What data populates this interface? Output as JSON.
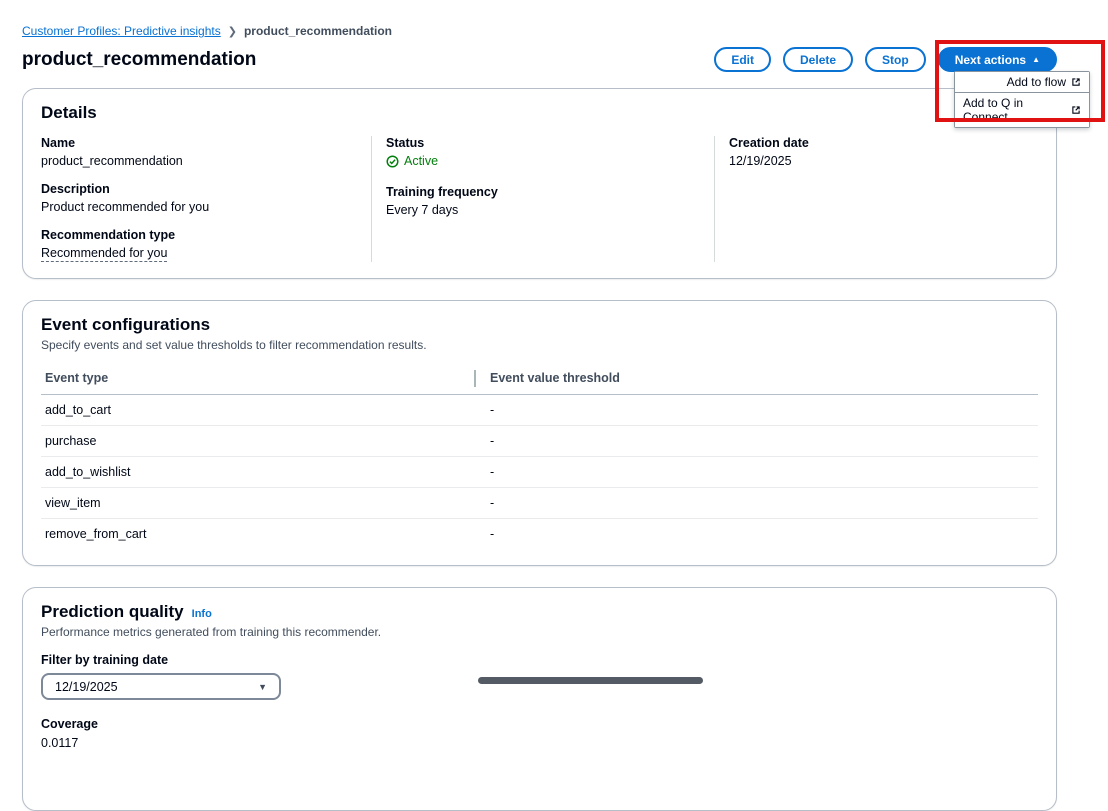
{
  "colors": {
    "accent": "#0972d3",
    "status_active": "#037f0c",
    "annotation": "#e01212"
  },
  "breadcrumb": {
    "link": "Customer Profiles: Predictive insights",
    "current": "product_recommendation"
  },
  "header": {
    "title": "product_recommendation",
    "edit_label": "Edit",
    "delete_label": "Delete",
    "stop_label": "Stop",
    "next_actions_label": "Next actions",
    "menu": [
      {
        "label": "Add to flow"
      },
      {
        "label": "Add to Q in Connect"
      }
    ]
  },
  "details": {
    "title": "Details",
    "name_label": "Name",
    "name_value": "product_recommendation",
    "description_label": "Description",
    "description_value": "Product recommended for you",
    "recommendation_type_label": "Recommendation type",
    "recommendation_type_value": "Recommended for you",
    "status_label": "Status",
    "status_value": "Active",
    "training_frequency_label": "Training frequency",
    "training_frequency_value": "Every 7 days",
    "creation_date_label": "Creation date",
    "creation_date_value": "12/19/2025"
  },
  "event_configurations": {
    "title": "Event configurations",
    "description": "Specify events and set value thresholds to filter recommendation results.",
    "columns": {
      "event_type": "Event type",
      "threshold": "Event value threshold"
    },
    "rows": [
      {
        "event_type": "add_to_cart",
        "threshold": "-"
      },
      {
        "event_type": "purchase",
        "threshold": "-"
      },
      {
        "event_type": "add_to_wishlist",
        "threshold": "-"
      },
      {
        "event_type": "view_item",
        "threshold": "-"
      },
      {
        "event_type": "remove_from_cart",
        "threshold": "-"
      }
    ]
  },
  "prediction_quality": {
    "title": "Prediction quality",
    "info_label": "Info",
    "description": "Performance metrics generated from training this recommender.",
    "filter_label": "Filter by training date",
    "filter_value": "12/19/2025",
    "coverage_label": "Coverage",
    "coverage_value": "0.0117"
  }
}
